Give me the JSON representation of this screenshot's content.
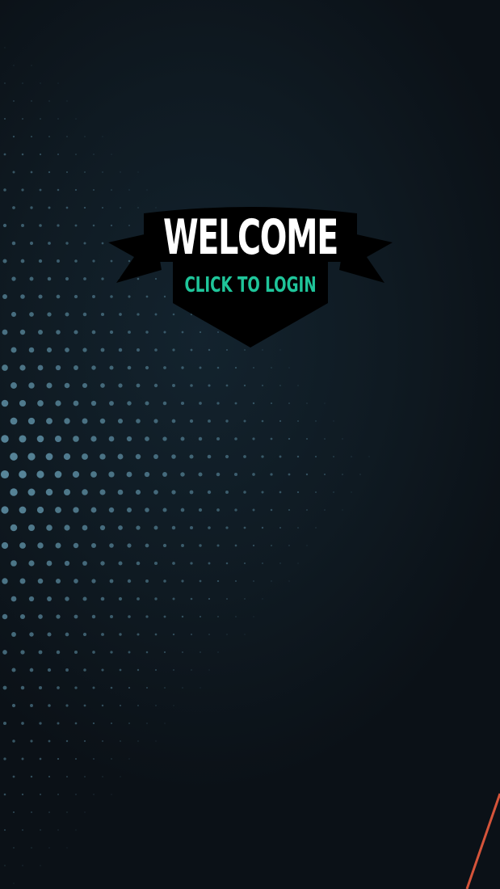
{
  "badge": {
    "title": "WELCOME",
    "action_label": "CLICK TO LOGIN"
  },
  "colors": {
    "background": "#0b1117",
    "dot": "#5d8ea3",
    "badge_fill": "#000000",
    "title": "#ffffff",
    "action": "#1fc59a",
    "accent_line": "#d5543a"
  }
}
